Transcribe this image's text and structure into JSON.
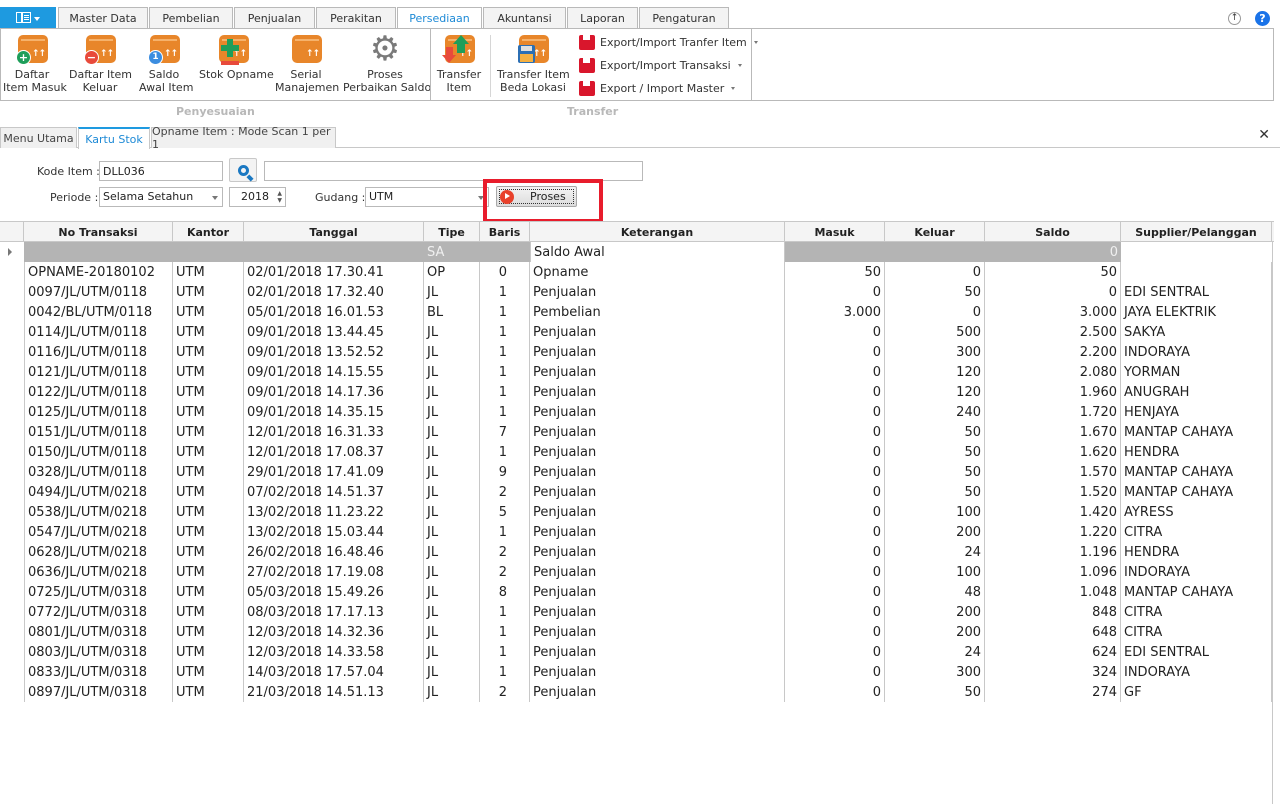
{
  "ribbon": {
    "app_menu": "app-menu",
    "tabs": [
      {
        "label": "Master Data",
        "active": false
      },
      {
        "label": "Pembelian",
        "active": false
      },
      {
        "label": "Penjualan",
        "active": false
      },
      {
        "label": "Perakitan",
        "active": false
      },
      {
        "label": "Persediaan",
        "active": true
      },
      {
        "label": "Akuntansi",
        "active": false
      },
      {
        "label": "Laporan",
        "active": false
      },
      {
        "label": "Pengaturan",
        "active": false
      }
    ],
    "buttons": {
      "daftar_item_masuk": [
        "Daftar",
        "Item Masuk"
      ],
      "daftar_item_keluar": [
        "Daftar Item",
        "Keluar"
      ],
      "saldo_awal_item": [
        "Saldo",
        "Awal Item"
      ],
      "stok_opname": [
        "Stok Opname",
        ""
      ],
      "serial_manajemen": [
        "Serial",
        "Manajemen"
      ],
      "proses_perbaikan_saldo": [
        "Proses",
        "Perbaikan Saldo"
      ],
      "transfer_item": [
        "Transfer",
        "Item"
      ],
      "transfer_item_beda_lokasi": [
        "Transfer Item",
        "Beda Lokasi"
      ]
    },
    "small_buttons": [
      "Export/Import Tranfer Item",
      "Export/Import Transaksi",
      "Export / Import Master"
    ],
    "groups": {
      "penyesuaian": "Penyesuaian",
      "transfer": "Transfer"
    },
    "badge_saldo": "1"
  },
  "doc_tabs": [
    {
      "label": "Menu Utama",
      "active": false
    },
    {
      "label": "Kartu Stok",
      "active": true
    },
    {
      "label": "Opname Item : Mode Scan 1 per 1",
      "active": false
    }
  ],
  "filter": {
    "kode_item_label": "Kode Item :",
    "kode_item_value": "DLL036",
    "item_name_value": "",
    "periode_label": "Periode :",
    "periode_value": "Selama Setahun",
    "year_value": "2018",
    "gudang_label": "Gudang :",
    "gudang_value": "UTM",
    "proses_label": "Proses"
  },
  "grid": {
    "columns": [
      "No Transaksi",
      "Kantor",
      "Tanggal",
      "Tipe",
      "Baris",
      "Keterangan",
      "Masuk",
      "Keluar",
      "Saldo",
      "Supplier/Pelanggan"
    ],
    "saldo_awal_row": {
      "tipe": "SA",
      "keterangan": "Saldo Awal",
      "saldo": "0"
    },
    "rows": [
      [
        "OPNAME-20180102",
        "UTM",
        "02/01/2018 17.30.41",
        "OP",
        "0",
        "Opname",
        "50",
        "0",
        "50",
        ""
      ],
      [
        "0097/JL/UTM/0118",
        "UTM",
        "02/01/2018 17.32.40",
        "JL",
        "1",
        "Penjualan",
        "0",
        "50",
        "0",
        "EDI SENTRAL"
      ],
      [
        "0042/BL/UTM/0118",
        "UTM",
        "05/01/2018 16.01.53",
        "BL",
        "1",
        "Pembelian",
        "3.000",
        "0",
        "3.000",
        "JAYA ELEKTRIK"
      ],
      [
        "0114/JL/UTM/0118",
        "UTM",
        "09/01/2018 13.44.45",
        "JL",
        "1",
        "Penjualan",
        "0",
        "500",
        "2.500",
        "SAKYA"
      ],
      [
        "0116/JL/UTM/0118",
        "UTM",
        "09/01/2018 13.52.52",
        "JL",
        "1",
        "Penjualan",
        "0",
        "300",
        "2.200",
        "INDORAYA"
      ],
      [
        "0121/JL/UTM/0118",
        "UTM",
        "09/01/2018 14.15.55",
        "JL",
        "1",
        "Penjualan",
        "0",
        "120",
        "2.080",
        "YORMAN"
      ],
      [
        "0122/JL/UTM/0118",
        "UTM",
        "09/01/2018 14.17.36",
        "JL",
        "1",
        "Penjualan",
        "0",
        "120",
        "1.960",
        "ANUGRAH"
      ],
      [
        "0125/JL/UTM/0118",
        "UTM",
        "09/01/2018 14.35.15",
        "JL",
        "1",
        "Penjualan",
        "0",
        "240",
        "1.720",
        "HENJAYA"
      ],
      [
        "0151/JL/UTM/0118",
        "UTM",
        "12/01/2018 16.31.33",
        "JL",
        "7",
        "Penjualan",
        "0",
        "50",
        "1.670",
        "MANTAP CAHAYA"
      ],
      [
        "0150/JL/UTM/0118",
        "UTM",
        "12/01/2018 17.08.37",
        "JL",
        "1",
        "Penjualan",
        "0",
        "50",
        "1.620",
        "HENDRA"
      ],
      [
        "0328/JL/UTM/0118",
        "UTM",
        "29/01/2018 17.41.09",
        "JL",
        "9",
        "Penjualan",
        "0",
        "50",
        "1.570",
        "MANTAP CAHAYA"
      ],
      [
        "0494/JL/UTM/0218",
        "UTM",
        "07/02/2018 14.51.37",
        "JL",
        "2",
        "Penjualan",
        "0",
        "50",
        "1.520",
        "MANTAP CAHAYA"
      ],
      [
        "0538/JL/UTM/0218",
        "UTM",
        "13/02/2018 11.23.22",
        "JL",
        "5",
        "Penjualan",
        "0",
        "100",
        "1.420",
        "AYRESS"
      ],
      [
        "0547/JL/UTM/0218",
        "UTM",
        "13/02/2018 15.03.44",
        "JL",
        "1",
        "Penjualan",
        "0",
        "200",
        "1.220",
        "CITRA"
      ],
      [
        "0628/JL/UTM/0218",
        "UTM",
        "26/02/2018 16.48.46",
        "JL",
        "2",
        "Penjualan",
        "0",
        "24",
        "1.196",
        "HENDRA"
      ],
      [
        "0636/JL/UTM/0218",
        "UTM",
        "27/02/2018 17.19.08",
        "JL",
        "2",
        "Penjualan",
        "0",
        "100",
        "1.096",
        "INDORAYA"
      ],
      [
        "0725/JL/UTM/0318",
        "UTM",
        "05/03/2018 15.49.26",
        "JL",
        "8",
        "Penjualan",
        "0",
        "48",
        "1.048",
        "MANTAP CAHAYA"
      ],
      [
        "0772/JL/UTM/0318",
        "UTM",
        "08/03/2018 17.17.13",
        "JL",
        "1",
        "Penjualan",
        "0",
        "200",
        "848",
        "CITRA"
      ],
      [
        "0801/JL/UTM/0318",
        "UTM",
        "12/03/2018 14.32.36",
        "JL",
        "1",
        "Penjualan",
        "0",
        "200",
        "648",
        "CITRA"
      ],
      [
        "0803/JL/UTM/0318",
        "UTM",
        "12/03/2018 14.33.58",
        "JL",
        "1",
        "Penjualan",
        "0",
        "24",
        "624",
        "EDI SENTRAL"
      ],
      [
        "0833/JL/UTM/0318",
        "UTM",
        "14/03/2018 17.57.04",
        "JL",
        "1",
        "Penjualan",
        "0",
        "300",
        "324",
        "INDORAYA"
      ],
      [
        "0897/JL/UTM/0318",
        "UTM",
        "21/03/2018 14.51.13",
        "JL",
        "2",
        "Penjualan",
        "0",
        "50",
        "274",
        "GF"
      ]
    ]
  },
  "colors": {
    "accent": "#1e9ae0",
    "highlight_border": "#e81c2c",
    "saldo_awal_row": "#b4b4b4",
    "box_icon": "#e8862a"
  }
}
